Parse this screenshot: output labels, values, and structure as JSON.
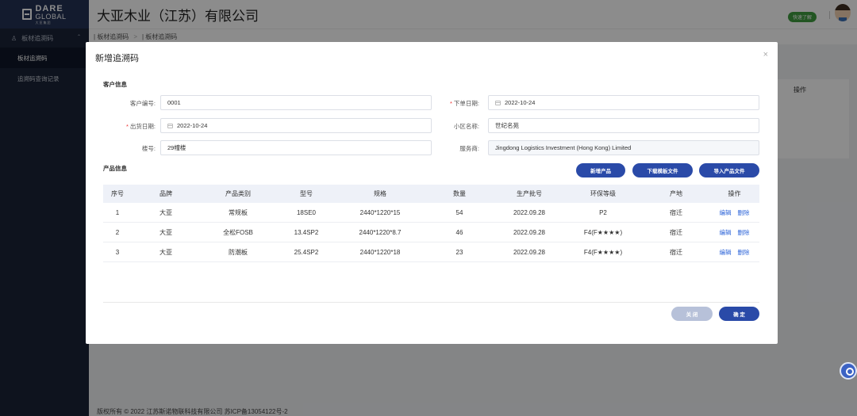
{
  "logo": {
    "line1": "DARE",
    "line2": "GLOBAL",
    "line3": "大亚集团"
  },
  "sidebar": {
    "group_label": "板材追溯码",
    "items": [
      {
        "label": "板材追溯码"
      },
      {
        "label": "追溯码查询记录"
      }
    ]
  },
  "header": {
    "company": "大亚木业（江苏）有限公司",
    "quick_button": "快速了解"
  },
  "breadcrumb": {
    "items": [
      "板材追溯码",
      "板材追溯码"
    ]
  },
  "background": {
    "ops_header": "操作"
  },
  "footer": {
    "text": "版权所有 © 2022 江苏斯诺物联科技有限公司 苏ICP备13054122号-2"
  },
  "modal": {
    "title": "新增追溯码",
    "close_glyph": "×",
    "customer_section": "客户信息",
    "product_section": "产品信息",
    "fields": {
      "customer_no": {
        "label": "客户编号:",
        "value": "0001"
      },
      "order_date": {
        "label": "下单日期:",
        "value": "2022-10-24",
        "required": true
      },
      "ship_date": {
        "label": "出货日期:",
        "value": "2022-10-24",
        "required": true
      },
      "community": {
        "label": "小区名称:",
        "value": "世纪名苑"
      },
      "building": {
        "label": "楼号:",
        "value": "29幢楼"
      },
      "provider": {
        "label": "服务商:",
        "value": "Jingdong Logistics Investment (Hong Kong) Limited"
      }
    },
    "buttons": {
      "add_product": "新增产品",
      "download_template": "下载模板文件",
      "import_products": "导入产品文件",
      "close": "关 闭",
      "confirm": "确 定"
    },
    "table": {
      "headers": [
        "序号",
        "品牌",
        "产品类别",
        "型号",
        "规格",
        "数量",
        "生产批号",
        "环保等级",
        "产地",
        "操作"
      ],
      "rows": [
        [
          "1",
          "大亚",
          "常规板",
          "18SE0",
          "2440*1220*15",
          "54",
          "2022.09.28",
          "P2",
          "宿迁"
        ],
        [
          "2",
          "大亚",
          "全松FOSB",
          "13.4SP2",
          "2440*1220*8.7",
          "46",
          "2022.09.28",
          "F4(F★★★★)",
          "宿迁"
        ],
        [
          "3",
          "大亚",
          "防潮板",
          "25.4SP2",
          "2440*1220*18",
          "23",
          "2022.09.28",
          "F4(F★★★★)",
          "宿迁"
        ]
      ],
      "edit_label": "编辑",
      "delete_label": "删除"
    }
  }
}
